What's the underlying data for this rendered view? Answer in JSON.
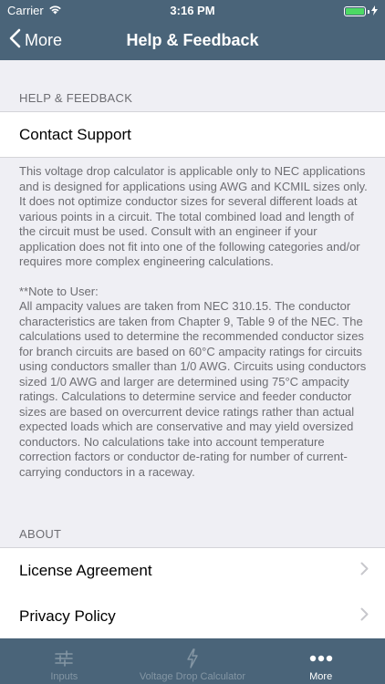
{
  "status_bar": {
    "carrier": "Carrier",
    "time": "3:16 PM"
  },
  "nav": {
    "back_label": "More",
    "title": "Help & Feedback"
  },
  "help_section": {
    "header": "HELP & FEEDBACK",
    "contact_support": "Contact Support",
    "description": "This voltage drop calculator is applicable only to NEC applications and is designed for applications using AWG and KCMIL sizes only. It does not optimize conductor sizes for several different loads at various points in a circuit. The total combined load and length of the circuit must be used. Consult with an engineer if your application does not fit into one of the following categories and/or requires more complex engineering calculations.",
    "note_heading": "**Note to User:",
    "note_body": "All ampacity values are taken from NEC 310.15. The conductor characteristics are taken from Chapter 9, Table 9 of the NEC. The calculations used to determine the recommended conductor sizes for branch circuits are based on 60°C ampacity ratings for circuits using conductors smaller than 1/0 AWG. Circuits using conductors sized 1/0 AWG and larger are determined using 75°C ampacity ratings. Calculations to determine service and feeder conductor sizes are based on overcurrent device ratings rather than actual expected loads which are conservative and may yield oversized conductors. No calculations take into account temperature correction factors or conductor de-rating for number of current-carrying conductors in a raceway."
  },
  "about_section": {
    "header": "ABOUT",
    "items": [
      {
        "label": "License Agreement"
      },
      {
        "label": "Privacy Policy"
      }
    ]
  },
  "tabs": [
    {
      "label": "Inputs",
      "icon": "sliders-icon",
      "active": false
    },
    {
      "label": "Voltage Drop Calculator",
      "icon": "lightning-icon",
      "active": false
    },
    {
      "label": "More",
      "icon": "more-dots-icon",
      "active": true
    }
  ],
  "colors": {
    "bar_background": "#4a6479",
    "battery": "#4cd964",
    "inactive_tab": "#8496a4"
  }
}
